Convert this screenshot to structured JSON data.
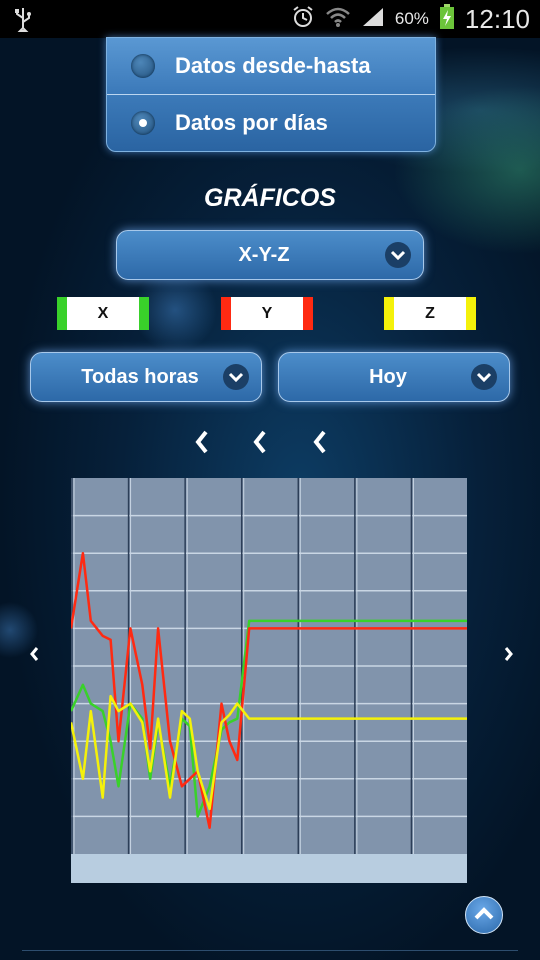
{
  "status_bar": {
    "battery_percent": "60%",
    "time": "12:10",
    "icons": [
      "usb-icon",
      "alarm-icon",
      "wifi-icon",
      "signal-icon",
      "battery-charging-icon"
    ]
  },
  "range_options": {
    "items": [
      {
        "label": "Datos desde-hasta",
        "selected": false
      },
      {
        "label": "Datos por días",
        "selected": true
      }
    ]
  },
  "section_title": "GRÁFICOS",
  "axis_select": {
    "value": "X-Y-Z",
    "icon": "chevron-down-icon"
  },
  "legend": [
    {
      "label": "X",
      "color": "#39d12a"
    },
    {
      "label": "Y",
      "color": "#ff2a12"
    },
    {
      "label": "Z",
      "color": "#f4f10a"
    }
  ],
  "hours_select": {
    "value": "Todas horas",
    "icon": "chevron-down-icon"
  },
  "day_select": {
    "value": "Hoy",
    "icon": "chevron-down-icon"
  },
  "navigation": {
    "prev_icons": [
      "chevron-left-icon",
      "chevron-left-icon",
      "chevron-left-icon"
    ],
    "left_icon": "chevron-left-icon",
    "right_icon": "chevron-right-icon"
  },
  "chart_data": {
    "type": "line",
    "title": "",
    "grid": true,
    "x": [
      0,
      3,
      5,
      8,
      10,
      12,
      15,
      18,
      20,
      22,
      25,
      28,
      30,
      32,
      35,
      38,
      40,
      42,
      45,
      48,
      50,
      52,
      55,
      58,
      60,
      62,
      65,
      68,
      70,
      72,
      75,
      78,
      80,
      82,
      85,
      88,
      90,
      92,
      95,
      98,
      100
    ],
    "series": [
      {
        "name": "X",
        "color": "#39d12a",
        "values": [
          0.38,
          0.45,
          0.4,
          0.38,
          0.3,
          0.18,
          0.4,
          0.36,
          0.2,
          0.35,
          0.18,
          0.36,
          0.34,
          0.1,
          0.18,
          0.33,
          0.35,
          0.36,
          0.62,
          0.62,
          0.62,
          0.62,
          0.62,
          0.62,
          0.62,
          0.62,
          0.62,
          0.62,
          0.62,
          0.62,
          0.62,
          0.62,
          0.62,
          0.62,
          0.62,
          0.62,
          0.62,
          0.62,
          0.62,
          0.62,
          0.62
        ]
      },
      {
        "name": "Y",
        "color": "#ff2a12",
        "values": [
          0.6,
          0.8,
          0.62,
          0.58,
          0.57,
          0.3,
          0.6,
          0.45,
          0.28,
          0.6,
          0.3,
          0.18,
          0.2,
          0.22,
          0.07,
          0.4,
          0.3,
          0.25,
          0.6,
          0.6,
          0.6,
          0.6,
          0.6,
          0.6,
          0.6,
          0.6,
          0.6,
          0.6,
          0.6,
          0.6,
          0.6,
          0.6,
          0.6,
          0.6,
          0.6,
          0.6,
          0.6,
          0.6,
          0.6,
          0.6,
          0.6
        ]
      },
      {
        "name": "Z",
        "color": "#f4f10a",
        "values": [
          0.35,
          0.2,
          0.38,
          0.15,
          0.42,
          0.38,
          0.4,
          0.35,
          0.22,
          0.36,
          0.15,
          0.38,
          0.36,
          0.22,
          0.12,
          0.35,
          0.37,
          0.4,
          0.36,
          0.36,
          0.36,
          0.36,
          0.36,
          0.36,
          0.36,
          0.36,
          0.36,
          0.36,
          0.36,
          0.36,
          0.36,
          0.36,
          0.36,
          0.36,
          0.36,
          0.36,
          0.36,
          0.36,
          0.36,
          0.36,
          0.36
        ]
      }
    ]
  }
}
